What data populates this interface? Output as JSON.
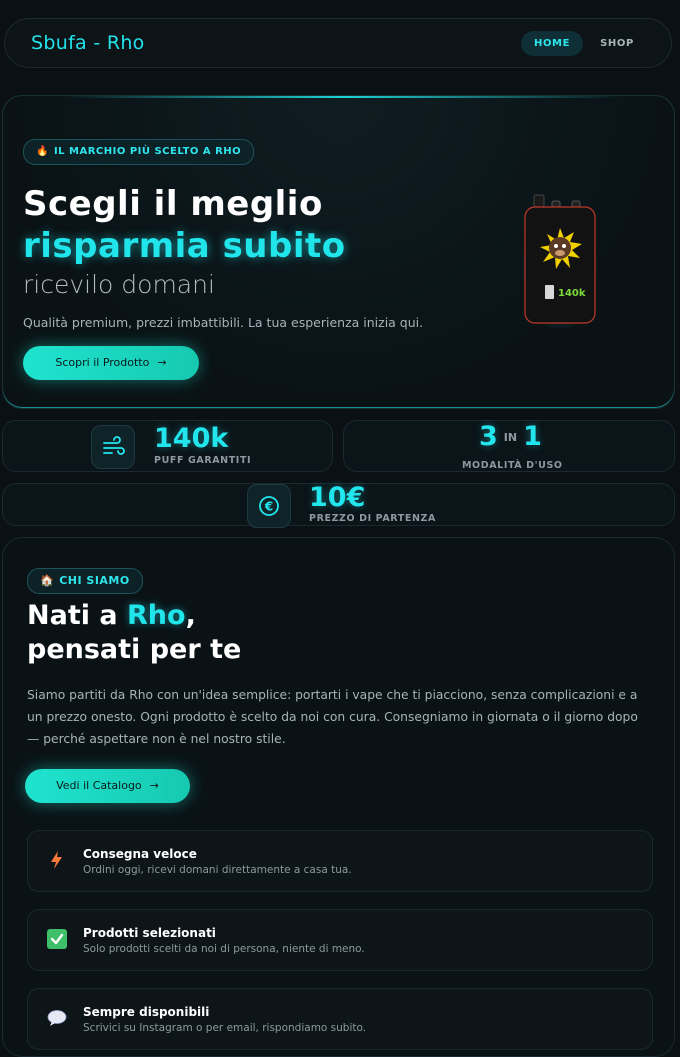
{
  "header": {
    "logo": "Sbufa - Rho",
    "nav": [
      {
        "label": "HOME"
      },
      {
        "label": "SHOP"
      }
    ]
  },
  "hero": {
    "badge": "IL MARCHIO PIÙ SCELTO A RHO",
    "title_line1": "Scegli il meglio",
    "title_line2": "risparmia subito",
    "title_line3": "ricevilo domani",
    "subtitle": "Qualità premium, prezzi imbattibili. La tua esperienza inizia qui.",
    "cta": "Scopri il Prodotto",
    "product_label": "140k"
  },
  "stats": {
    "puff_value": "140k",
    "puff_label": "PUFF GARANTITI",
    "mode_num1": "3",
    "mode_in": "IN",
    "mode_num2": "1",
    "mode_label": "MODALITÀ D'USO",
    "price_value": "10€",
    "price_label": "PREZZO DI PARTENZA"
  },
  "about": {
    "badge": "CHI SIAMO",
    "title_a": "Nati a ",
    "title_highlight": "Rho",
    "title_comma": ",",
    "title_b": "pensati per te",
    "paragraph": "Siamo partiti da Rho con un'idea semplice: portarti i vape che ti piacciono, senza complicazioni e a un prezzo onesto. Ogni prodotto è scelto da noi con cura. Consegniamo in giornata o il giorno dopo — perché aspettare non è nel nostro stile.",
    "cta": "Vedi il Catalogo",
    "features": [
      {
        "title": "Consegna veloce",
        "text": "Ordini oggi, ricevi domani direttamente a casa tua.",
        "icon": "lightning-icon"
      },
      {
        "title": "Prodotti selezionati",
        "text": "Solo prodotti scelti da noi di persona, niente di meno.",
        "icon": "check-icon"
      },
      {
        "title": "Sempre disponibili",
        "text": "Scrivici su Instagram o per email, rispondiamo subito.",
        "icon": "chat-bubble-icon"
      }
    ]
  },
  "colors": {
    "accent": "#22e6ee",
    "cta_start": "#1fe3cf",
    "background": "#0a1014"
  }
}
